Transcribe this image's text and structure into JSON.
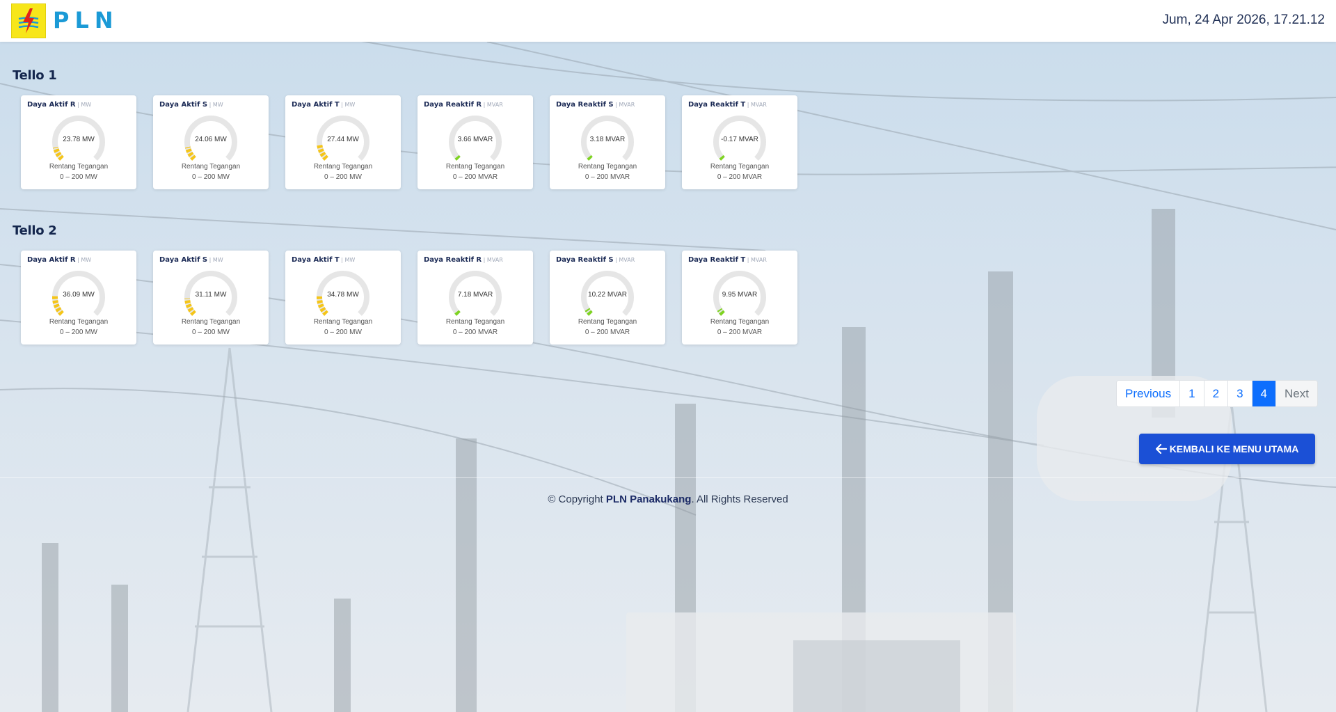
{
  "header": {
    "brand": "PLN",
    "datetime": "Jum, 24 Apr 2026, 17.21.12"
  },
  "sections": [
    {
      "title": "Tello 1",
      "cards": [
        {
          "name": "Daya Aktif R",
          "unit": "MW",
          "value_text": "23.78 MW",
          "value": 23.78,
          "max": 200,
          "color": "#f5c518",
          "label": "Rentang Tegangan",
          "range": "0 – 200 MW"
        },
        {
          "name": "Daya Aktif S",
          "unit": "MW",
          "value_text": "24.06 MW",
          "value": 24.06,
          "max": 200,
          "color": "#f5c518",
          "label": "Rentang Tegangan",
          "range": "0 – 200 MW"
        },
        {
          "name": "Daya Aktif T",
          "unit": "MW",
          "value_text": "27.44 MW",
          "value": 27.44,
          "max": 200,
          "color": "#f5c518",
          "label": "Rentang Tegangan",
          "range": "0 – 200 MW"
        },
        {
          "name": "Daya Reaktif R",
          "unit": "MVAR",
          "value_text": "3.66 MVAR",
          "value": 3.66,
          "max": 200,
          "color": "#7ed321",
          "label": "Rentang Tegangan",
          "range": "0 – 200 MVAR"
        },
        {
          "name": "Daya Reaktif S",
          "unit": "MVAR",
          "value_text": "3.18 MVAR",
          "value": 3.18,
          "max": 200,
          "color": "#7ed321",
          "label": "Rentang Tegangan",
          "range": "0 – 200 MVAR"
        },
        {
          "name": "Daya Reaktif T",
          "unit": "MVAR",
          "value_text": "-0.17 MVAR",
          "value": -0.17,
          "max": 200,
          "color": "#7ed321",
          "label": "Rentang Tegangan",
          "range": "0 – 200 MVAR"
        }
      ]
    },
    {
      "title": "Tello 2",
      "cards": [
        {
          "name": "Daya Aktif R",
          "unit": "MW",
          "value_text": "36.09 MW",
          "value": 36.09,
          "max": 200,
          "color": "#f5c518",
          "label": "Rentang Tegangan",
          "range": "0 – 200 MW"
        },
        {
          "name": "Daya Aktif S",
          "unit": "MW",
          "value_text": "31.11 MW",
          "value": 31.11,
          "max": 200,
          "color": "#f5c518",
          "label": "Rentang Tegangan",
          "range": "0 – 200 MW"
        },
        {
          "name": "Daya Aktif T",
          "unit": "MW",
          "value_text": "34.78 MW",
          "value": 34.78,
          "max": 200,
          "color": "#f5c518",
          "label": "Rentang Tegangan",
          "range": "0 – 200 MW"
        },
        {
          "name": "Daya Reaktif R",
          "unit": "MVAR",
          "value_text": "7.18 MVAR",
          "value": 7.18,
          "max": 200,
          "color": "#7ed321",
          "label": "Rentang Tegangan",
          "range": "0 – 200 MVAR"
        },
        {
          "name": "Daya Reaktif S",
          "unit": "MVAR",
          "value_text": "10.22 MVAR",
          "value": 10.22,
          "max": 200,
          "color": "#7ed321",
          "label": "Rentang Tegangan",
          "range": "0 – 200 MVAR"
        },
        {
          "name": "Daya Reaktif T",
          "unit": "MVAR",
          "value_text": "9.95 MVAR",
          "value": 9.95,
          "max": 200,
          "color": "#7ed321",
          "label": "Rentang Tegangan",
          "range": "0 – 200 MVAR"
        }
      ]
    }
  ],
  "pagination": {
    "previous": "Previous",
    "pages": [
      "1",
      "2",
      "3",
      "4"
    ],
    "active": "4",
    "next": "Next"
  },
  "back_button": {
    "label": "KEMBALI KE MENU UTAMA",
    "icon": "arrow-left-icon"
  },
  "footer": {
    "prefix": "© Copyright ",
    "brand": "PLN Panakukang",
    "suffix": ". All Rights Reserved"
  },
  "colors": {
    "track": "#e6e6e6",
    "brand": "#1b9ad6",
    "logo_bg": "#f7e61a",
    "button": "#1b50d6",
    "active_page": "#0d6efd"
  }
}
